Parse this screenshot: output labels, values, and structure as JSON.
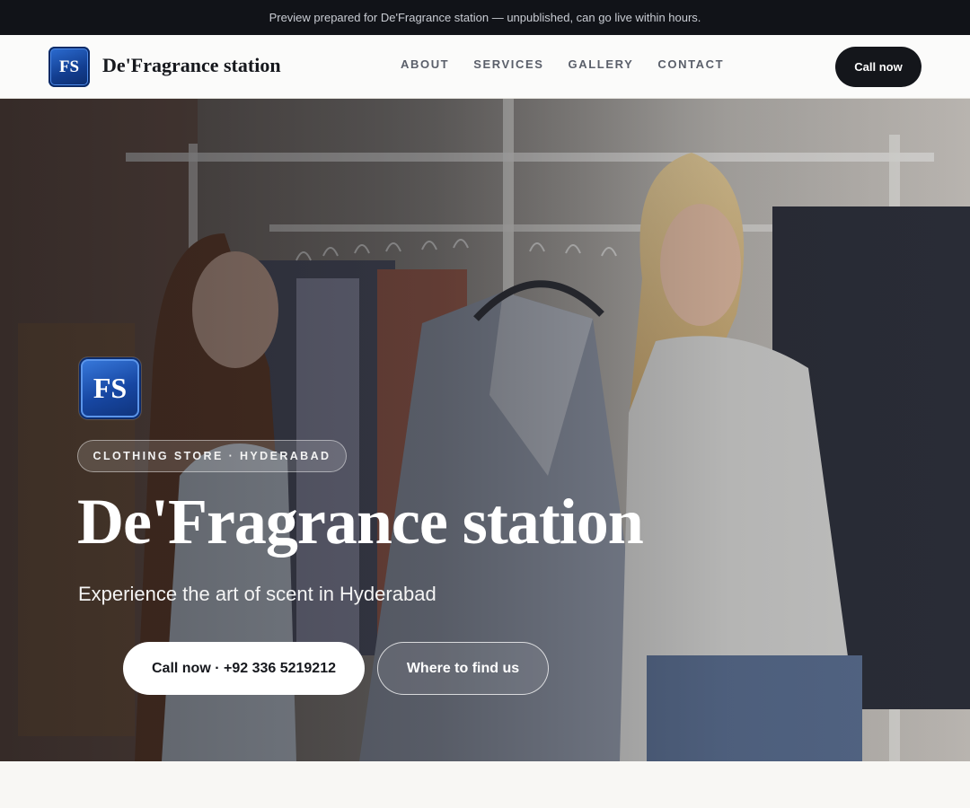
{
  "preview_banner": "Preview prepared for De'Fragrance station — unpublished, can go live within hours.",
  "header": {
    "logo_initials": "FS",
    "brand_name": "De'Fragrance station",
    "nav": [
      "ABOUT",
      "SERVICES",
      "GALLERY",
      "CONTACT"
    ],
    "call_button": "Call now"
  },
  "hero": {
    "logo_initials": "FS",
    "category_pill": "CLOTHING STORE · HYDERABAD",
    "title": "De'Fragrance station",
    "subtitle": "Experience the art of scent in Hyderabad",
    "primary_button": "Call now · +92 336 5219212",
    "secondary_button": "Where to find us"
  },
  "colors": {
    "topbar_bg": "#111318",
    "header_bg": "#fbfbfa",
    "logo_blue": "#1747a3",
    "dark_button": "#14161b"
  }
}
